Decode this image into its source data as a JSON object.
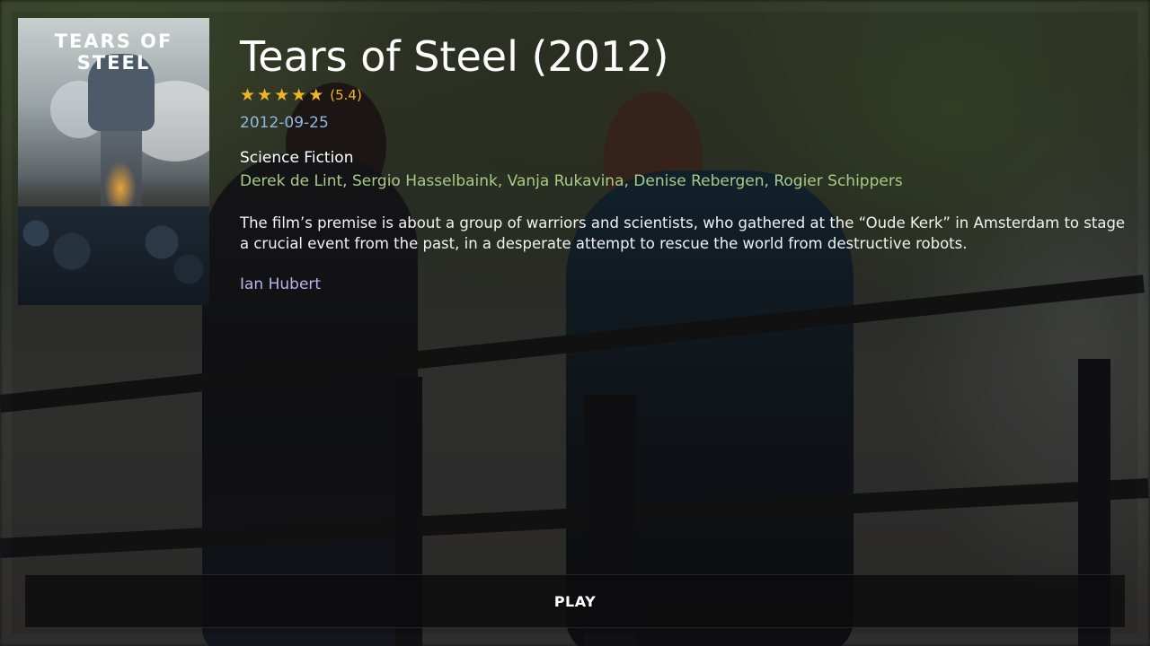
{
  "movie": {
    "title": "Tears of Steel (2012)",
    "rating": {
      "stars": 5,
      "value_text": "(5.4)",
      "color": "#f0b429"
    },
    "release_date": "2012-09-25",
    "genre": "Science Fiction",
    "cast": "Derek de Lint, Sergio Hasselbaink, Vanja Rukavina, Denise Rebergen, Rogier Schippers",
    "overview": "The film’s premise is about a group of warriors and scientists, who gathered at the “Oude Kerk” in Amsterdam to stage a crucial event from the past, in a desperate attempt to rescue the world from destructive robots.",
    "director": "Ian Hubert"
  },
  "poster": {
    "title_text": "TEARS OF STEEL"
  },
  "actions": {
    "play_label": "PLAY"
  },
  "colors": {
    "date": "#8fb9e3",
    "cast": "#a8cc86",
    "director": "#b7b4ec",
    "star": "#f0b429"
  }
}
